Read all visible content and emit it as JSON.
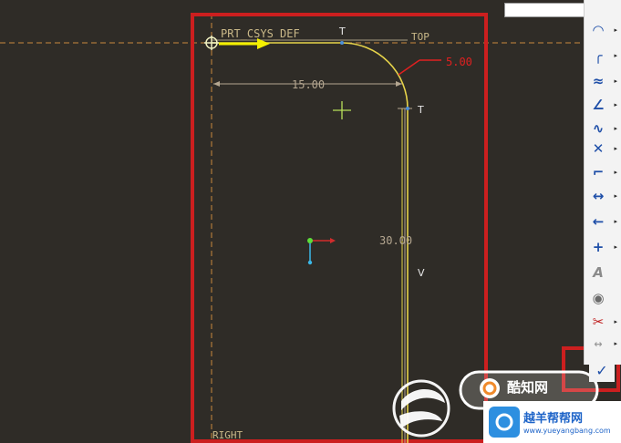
{
  "sketch": {
    "csys_label": "PRT_CSYS_DEF",
    "top_label": "TOP",
    "right_label": "RIGHT",
    "dim_width": "15.00",
    "dim_height": "30.00",
    "dim_radius": "5.00",
    "tangent_mark_1": "T",
    "tangent_mark_2": "T",
    "vertical_mark": "V"
  },
  "toolbar": {
    "tools": [
      {
        "icon": "arc-icon",
        "glyph": "◠"
      },
      {
        "icon": "fillet-icon",
        "glyph": "╭"
      },
      {
        "icon": "spline-icon",
        "glyph": "≈"
      },
      {
        "icon": "sketch-point-icon",
        "glyph": "✕"
      },
      {
        "icon": "offset-edge-icon",
        "glyph": "⌐"
      },
      {
        "icon": "dimension-icon",
        "glyph": "↔"
      },
      {
        "icon": "modify-icon",
        "glyph": "←"
      },
      {
        "icon": "constraint-icon",
        "glyph": "+"
      },
      {
        "icon": "text-icon",
        "glyph": "A"
      },
      {
        "icon": "palette-icon",
        "glyph": "◉"
      },
      {
        "icon": "trim-icon",
        "glyph": "✂"
      },
      {
        "icon": "mirror-icon",
        "glyph": "↔"
      },
      {
        "icon": "done-checkmark-icon",
        "glyph": "✓"
      }
    ]
  },
  "watermark": {
    "text_1": "酷知网",
    "text_2": "越羊帮帮网",
    "url": "www.yueyangbang.com"
  },
  "colors": {
    "background": "#2f2c27",
    "highlight_frame": "#cc1f1f",
    "sketch_line": "#e6d34a",
    "dim_line": "#b4a690",
    "datum": "#c9893c",
    "dim_red": "#e02020"
  }
}
